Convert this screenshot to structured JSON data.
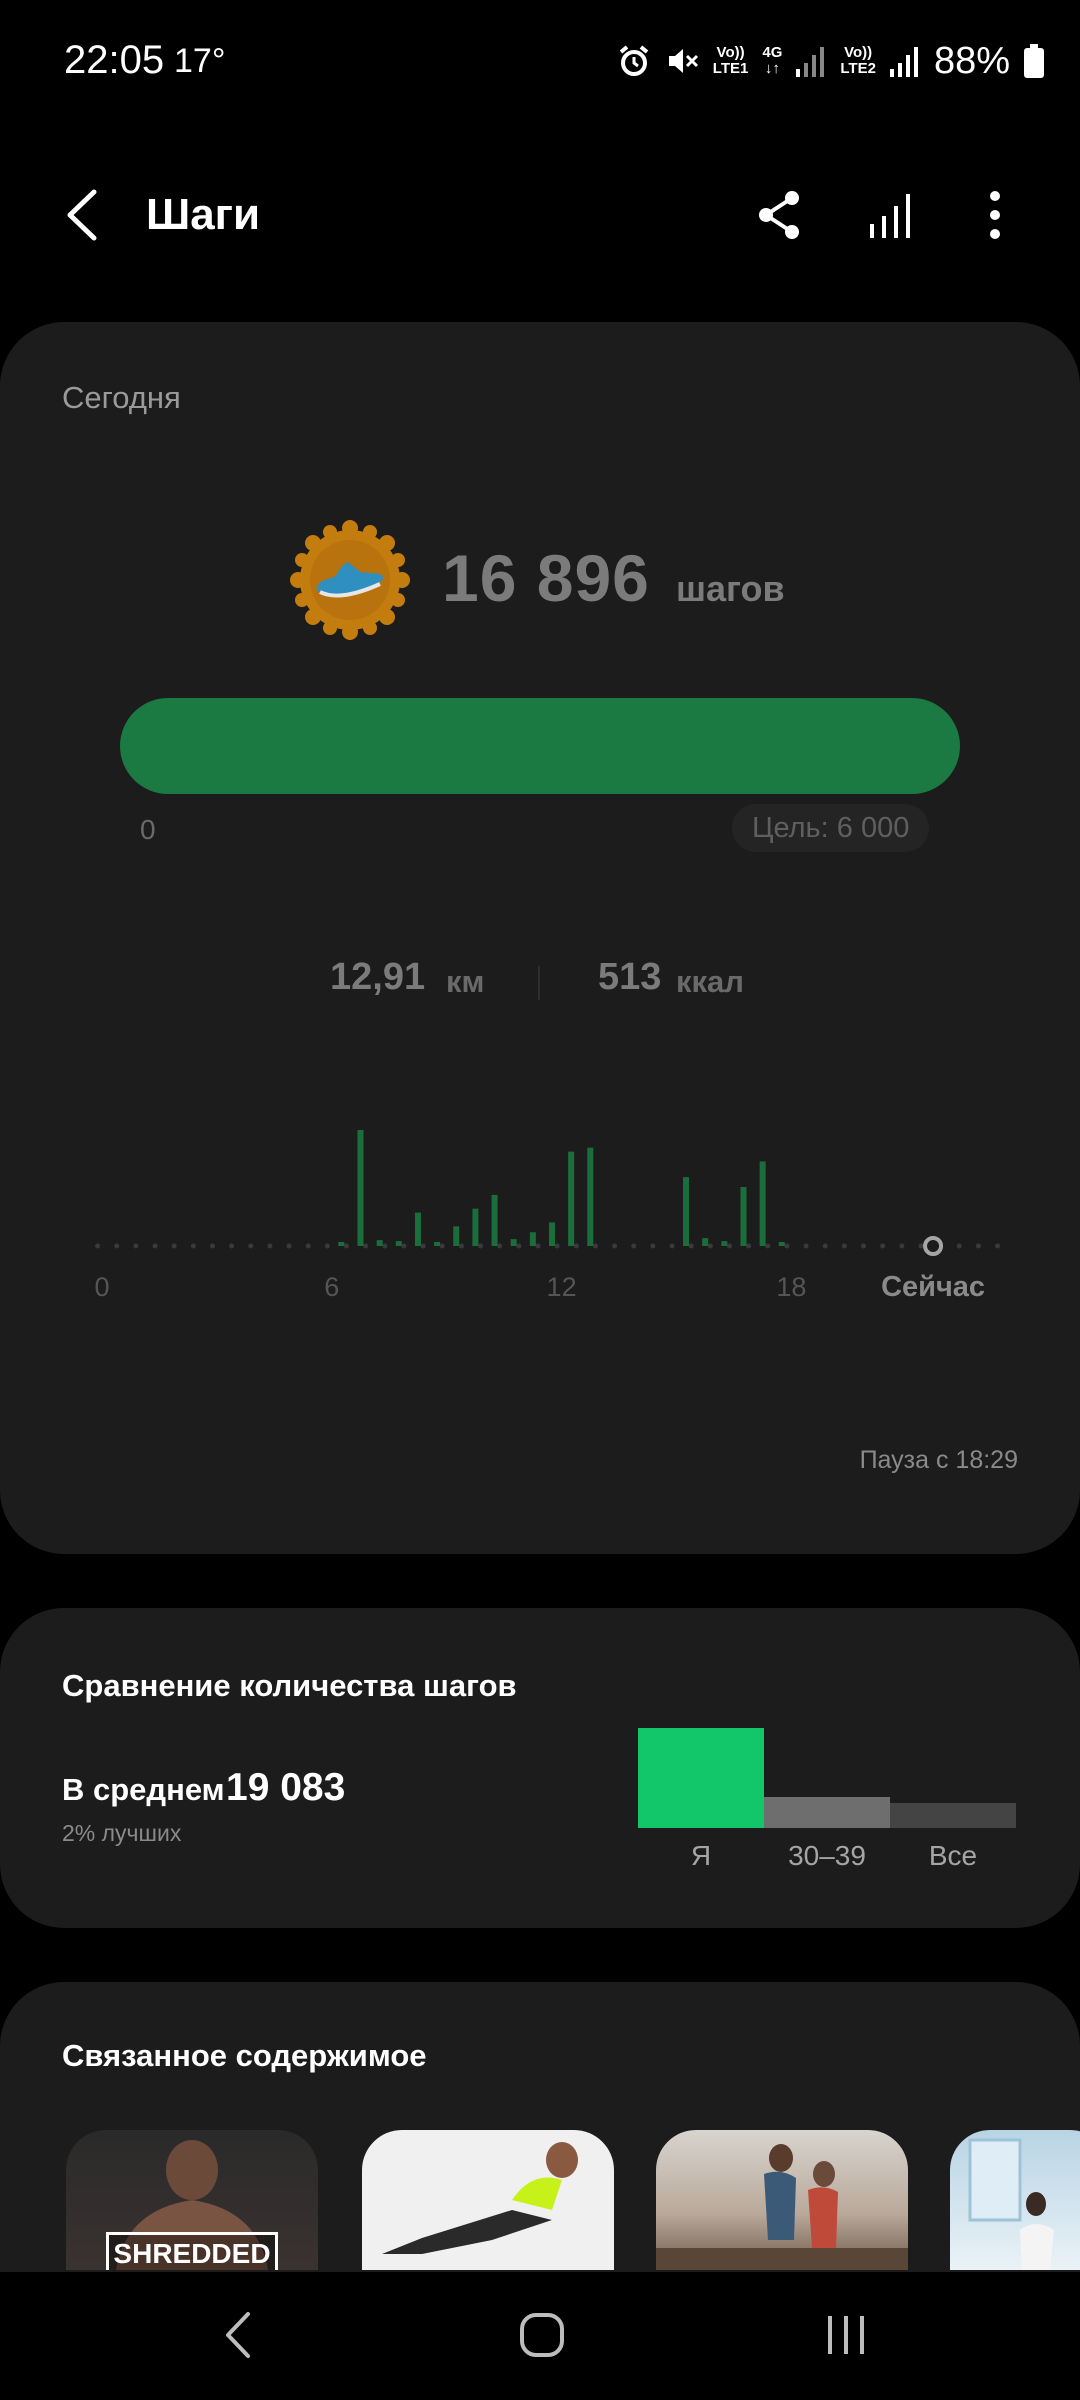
{
  "status_bar": {
    "time": "22:05",
    "temperature": "17°",
    "volte1_top": "Vo))",
    "volte1_bottom": "LTE1",
    "net_type": "4G",
    "volte2_top": "Vo))",
    "volte2_bottom": "LTE2",
    "battery": "88%"
  },
  "header": {
    "title": "Шаги"
  },
  "today": {
    "label": "Сегодня",
    "steps": "16 896",
    "steps_unit": "шагов",
    "progress_start": "0",
    "goal": "Цель: 6 000",
    "goal_fraction": 1.0,
    "distance_value": "12,91",
    "distance_unit": "км",
    "calories_value": "513",
    "calories_unit": "ккал",
    "pause": "Пауза с 18:29",
    "accent_color": "#1b7a42"
  },
  "chart_data": {
    "type": "bar",
    "x_tick_labels": [
      "0",
      "6",
      "12",
      "18",
      "Сейчас"
    ],
    "x_ticks": [
      0,
      6,
      12,
      18,
      21.7
    ],
    "x_range": [
      0,
      23.5
    ],
    "bar_x": [
      6.25,
      6.75,
      7.25,
      7.75,
      8.25,
      8.75,
      9.25,
      9.75,
      10.25,
      10.75,
      11.25,
      11.75,
      12.25,
      12.75,
      15.25,
      15.75,
      16.25,
      16.75,
      17.25,
      17.75
    ],
    "bar_values": [
      4,
      118,
      6,
      5,
      34,
      4,
      20,
      38,
      52,
      7,
      14,
      24,
      96,
      100,
      70,
      8,
      5,
      60,
      86,
      4
    ],
    "y_range": [
      0,
      120
    ],
    "now_marker_x": 21.7,
    "grid": false,
    "bar_color": "#1b6e3c"
  },
  "comparison": {
    "title": "Сравнение количества шагов",
    "average_label": "В среднем",
    "average_value": "19 083",
    "rank": "2% лучших",
    "bars": [
      {
        "label": "Я",
        "value": 1.0,
        "color": "#12c769"
      },
      {
        "label": "30–39",
        "value": 0.31,
        "color": "#6e6e6e"
      },
      {
        "label": "Все",
        "value": 0.25,
        "color": "#444444"
      }
    ]
  },
  "related": {
    "title": "Связанное содержимое",
    "thumb1_text": "SHREDDED"
  }
}
